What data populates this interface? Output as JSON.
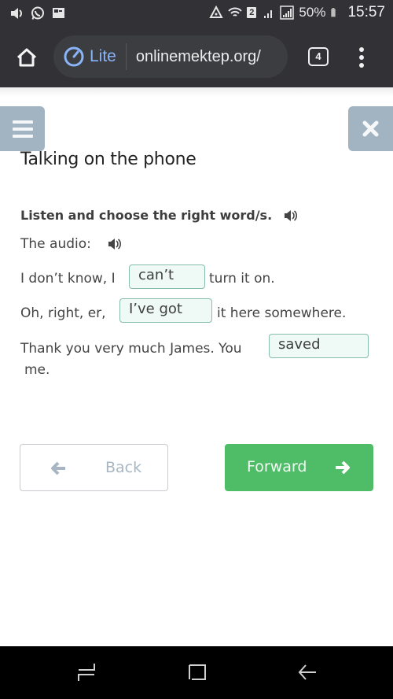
{
  "status_bar": {
    "left_icons": [
      "volume-icon",
      "whatsapp-icon",
      "gallery-icon"
    ],
    "right_icons": [
      "network-warning-icon",
      "wifi-icon",
      "sim-2-badge",
      "signal-icon",
      "signal-full-icon",
      "battery-icon"
    ],
    "sim_badge": "2",
    "battery_percent": "50%",
    "time": "15:57"
  },
  "browser": {
    "lite_label": "Lite",
    "url": "onlinemektep.org/",
    "tab_count": "4"
  },
  "page": {
    "title": "Talking on the phone",
    "instruction": "Listen and choose the right word/s.",
    "audio_label": "The audio:",
    "sentences": [
      {
        "before": "I don’t know, I",
        "answer": "can’t",
        "after": "turn it on."
      },
      {
        "before": "Oh, right, er,",
        "answer": "I’ve got",
        "after": "it here somewhere."
      },
      {
        "before": "Thank you very much James. You",
        "answer": "saved",
        "after": "me."
      }
    ],
    "back_label": "Back",
    "forward_label": "Forward"
  },
  "colors": {
    "accent_green": "#4fbd68",
    "side_button": "#a2b4c1",
    "gap_border": "#86bdae",
    "gap_fill": "#effaf6"
  },
  "system_nav": [
    "recent-apps-icon",
    "home-icon",
    "back-icon"
  ]
}
